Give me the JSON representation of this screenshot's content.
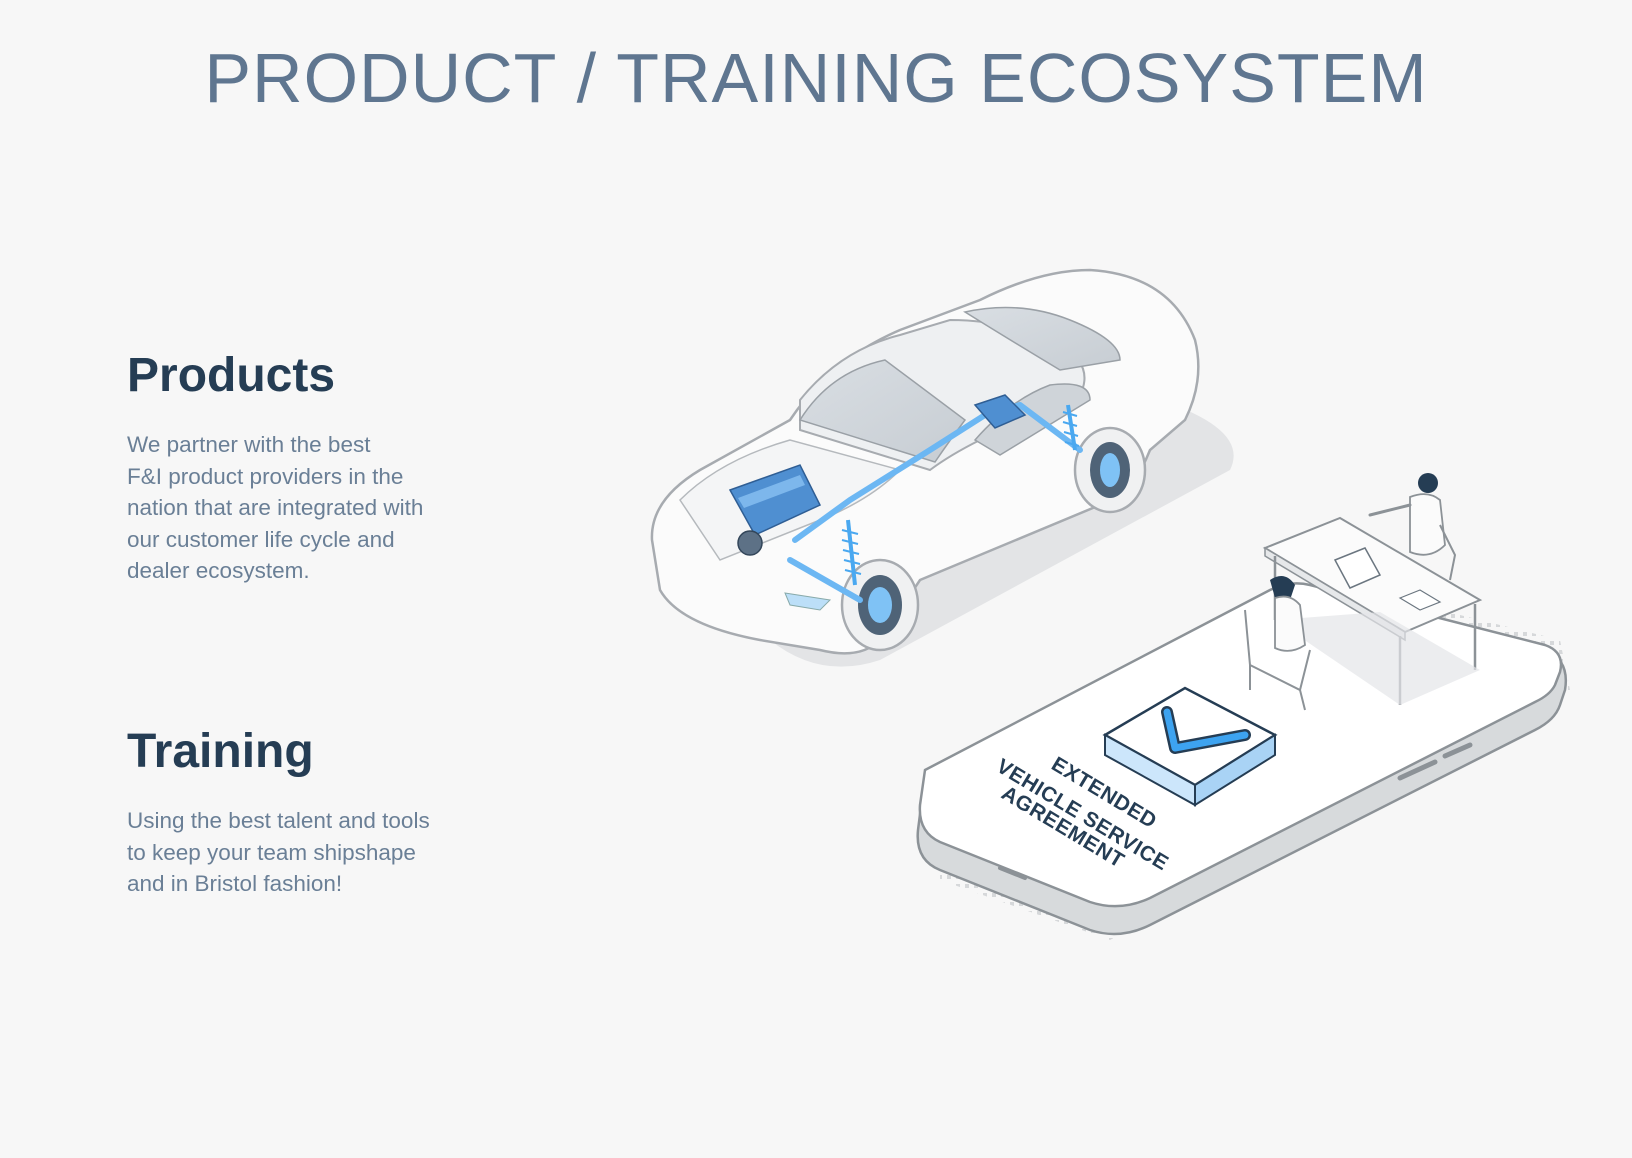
{
  "title": "PRODUCT / TRAINING ECOSYSTEM",
  "products": {
    "heading": "Products",
    "lines": [
      "We partner with the best",
      "F&I product providers in the",
      "nation that are integrated with",
      "our customer life cycle and",
      "dealer ecosystem."
    ]
  },
  "training": {
    "heading": "Training",
    "lines": [
      "Using the best talent and tools",
      "to keep your team shipshape",
      "and in Bristol fashion!"
    ]
  },
  "illustration": {
    "phone_screen_lines": [
      "EXTENDED",
      "VEHICLE SERVICE",
      "AGREEMENT"
    ]
  },
  "colors": {
    "title": "#5f7690",
    "heading": "#253d54",
    "body": "#6a7f96",
    "accent_blue": "#4aa8f0",
    "background": "#f7f7f7"
  }
}
